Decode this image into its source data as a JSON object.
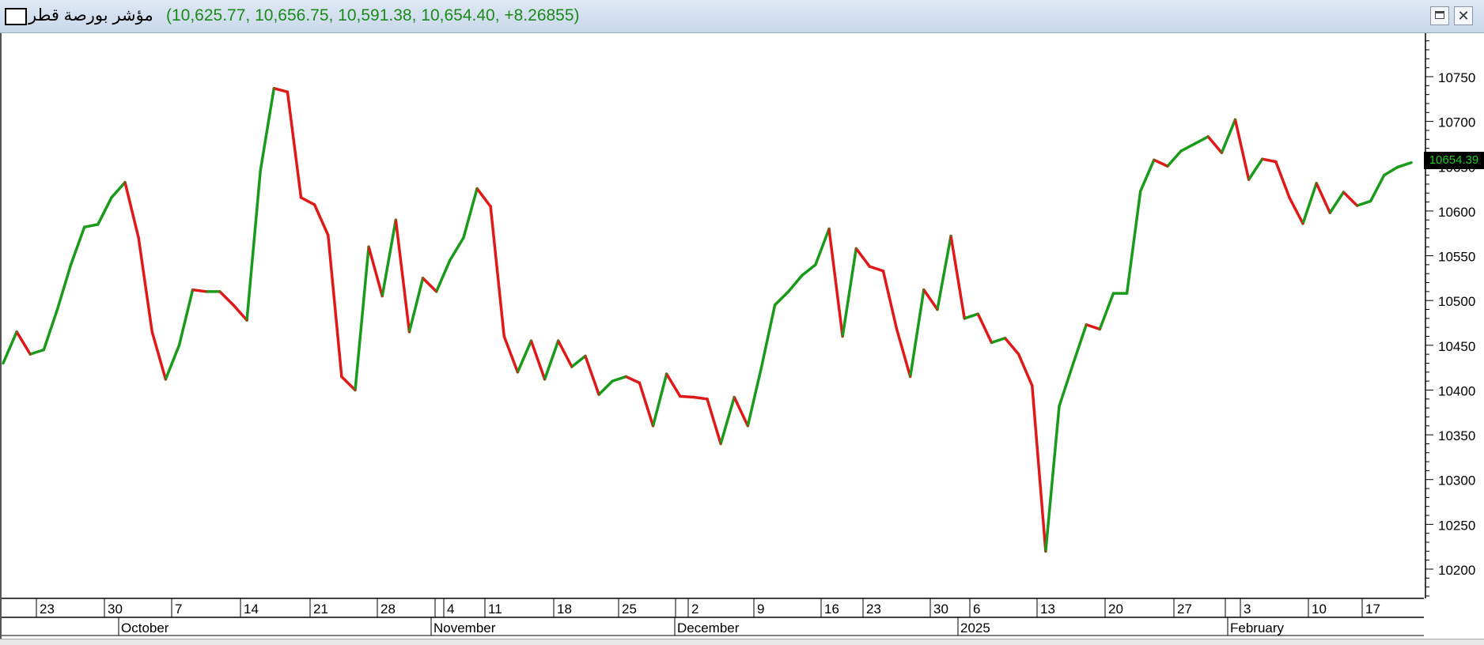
{
  "window": {
    "title": "مؤشر بورصة قطر",
    "values_text": "(10,625.77, 10,656.75, 10,591.38, 10,654.40, +8.26855)",
    "restore_icon": "restore-icon",
    "close_icon": "close-icon",
    "close_glyph": "✕"
  },
  "colors": {
    "up": "#1a9a1a",
    "down": "#e01818",
    "axis": "#000000",
    "title_values": "#1a8a1a",
    "price_tag_bg": "#000000",
    "price_tag_fg": "#22c822"
  },
  "last_price_label": "10654.39",
  "chart_data": {
    "type": "line",
    "title": "",
    "xlabel": "",
    "ylabel": "",
    "ylim": [
      10165,
      10790
    ],
    "y_ticks": [
      10200,
      10250,
      10300,
      10350,
      10400,
      10450,
      10500,
      10550,
      10600,
      10650,
      10700,
      10750
    ],
    "y_tick_labels": [
      "10200",
      "10250",
      "10300",
      "10350",
      "10400",
      "10450",
      "10500",
      "10550",
      "10600",
      "10650",
      "10700",
      "10750"
    ],
    "grid": false,
    "color_rule": "segment green when rising, red when falling",
    "x_day_labels": [
      "23",
      "30",
      "7",
      "14",
      "21",
      "28",
      "4",
      "11",
      "18",
      "25",
      "2",
      "9",
      "16",
      "23",
      "30",
      "6",
      "13",
      "20",
      "27",
      "3",
      "10",
      "17"
    ],
    "x_month_labels": [
      "October",
      "November",
      "December",
      "2025",
      "February"
    ],
    "series": [
      {
        "values": [
          10430,
          10465,
          10440,
          10445,
          10490,
          10540,
          10582,
          10585,
          10615,
          10632,
          10570,
          10465,
          10412,
          10450,
          10512,
          10510,
          10510,
          10495,
          10478,
          10645,
          10737,
          10733,
          10615,
          10607,
          10573,
          10415,
          10400,
          10560,
          10505,
          10590,
          10465,
          10525,
          10510,
          10545,
          10570,
          10625,
          10605,
          10460,
          10420,
          10455,
          10412,
          10455,
          10426,
          10438,
          10395,
          10410,
          10415,
          10408,
          10360,
          10418,
          10393,
          10392,
          10390,
          10340,
          10392,
          10360,
          10425,
          10495,
          10510,
          10528,
          10540,
          10580,
          10460,
          10558,
          10538,
          10533,
          10468,
          10415,
          10512,
          10490,
          10572,
          10480,
          10485,
          10453,
          10458,
          10440,
          10405,
          10220,
          10382,
          10428,
          10473,
          10468,
          10508,
          10508,
          10622,
          10657,
          10650,
          10667,
          10675,
          10683,
          10665,
          10702,
          10635,
          10658,
          10655,
          10615,
          10586,
          10631,
          10598,
          10621,
          10606,
          10611,
          10640,
          10649,
          10654
        ]
      }
    ]
  }
}
